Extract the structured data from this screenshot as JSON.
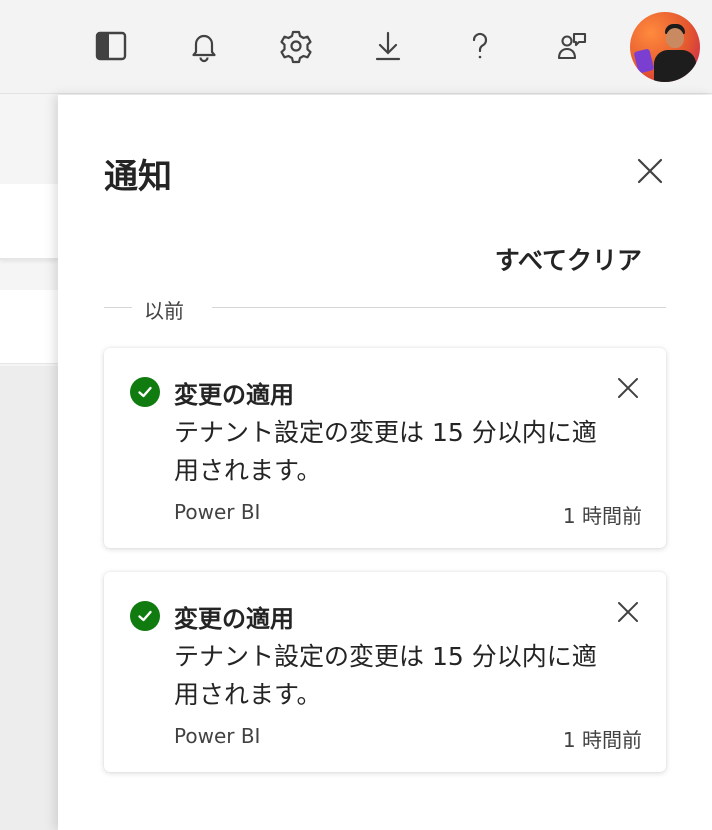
{
  "topbar": {
    "icons": [
      {
        "name": "pane-toggle-icon"
      },
      {
        "name": "bell-icon"
      },
      {
        "name": "gear-icon"
      },
      {
        "name": "download-icon"
      },
      {
        "name": "help-icon"
      },
      {
        "name": "feedback-icon"
      }
    ]
  },
  "panel": {
    "title": "通知",
    "clear_all": "すべてクリア",
    "section_label": "以前"
  },
  "notifications": [
    {
      "title": "変更の適用",
      "body": "テナント設定の変更は 15 分以内に適用されます。",
      "source": "Power BI",
      "time": "1 時間前"
    },
    {
      "title": "変更の適用",
      "body": "テナント設定の変更は 15 分以内に適用されます。",
      "source": "Power BI",
      "time": "1 時間前"
    }
  ],
  "colors": {
    "success": "#107c10",
    "panel_bg": "#ffffff",
    "topbar_bg": "#f3f3f3"
  }
}
